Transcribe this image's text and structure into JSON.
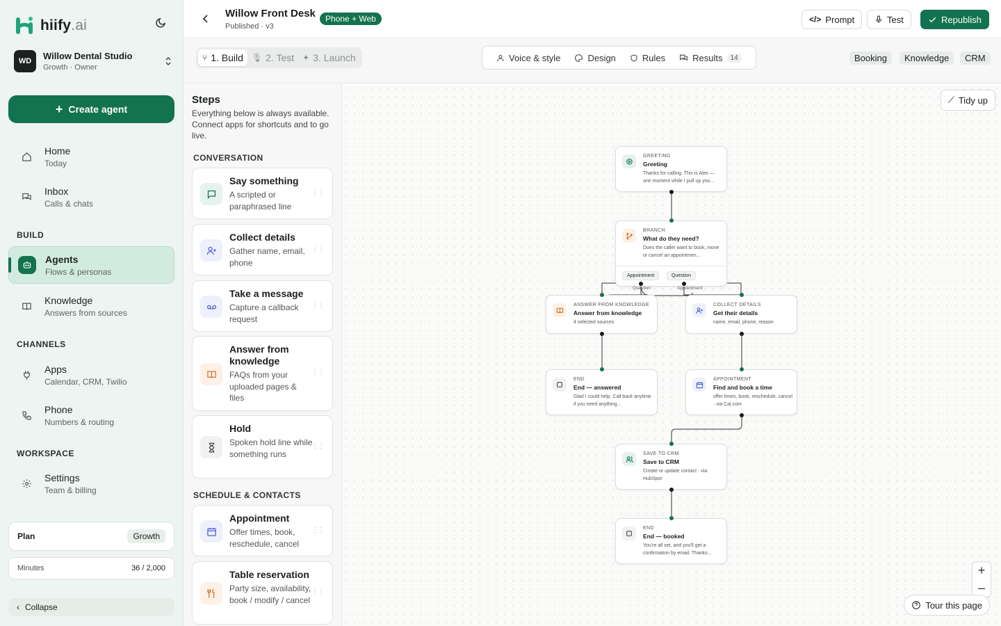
{
  "brand": {
    "name": "hiify",
    "suffix": ".ai",
    "accent": "#13724f"
  },
  "workspace": {
    "initials": "WD",
    "name": "Willow Dental Studio",
    "sub": "Growth · Owner"
  },
  "create_label": "Create agent",
  "nav": {
    "home": {
      "title": "Home",
      "sub": "Today"
    },
    "inbox": {
      "title": "Inbox",
      "sub": "Calls & chats"
    },
    "build_label": "BUILD",
    "agents": {
      "title": "Agents",
      "sub": "Flows & personas"
    },
    "knowledge": {
      "title": "Knowledge",
      "sub": "Answers from sources"
    },
    "channels_label": "CHANNELS",
    "apps": {
      "title": "Apps",
      "sub": "Calendar, CRM, Twilio"
    },
    "phone": {
      "title": "Phone",
      "sub": "Numbers & routing"
    },
    "workspace_label": "WORKSPACE",
    "settings": {
      "title": "Settings",
      "sub": "Team & billing"
    }
  },
  "plan": {
    "label": "Plan",
    "value": "Growth"
  },
  "minutes": {
    "label": "Minutes",
    "value": "36 / 2,000"
  },
  "collapse_label": "Collapse",
  "header": {
    "title": "Willow Front Desk",
    "subtitle": "Published · v3",
    "badge": "Phone + Web",
    "prompt": "Prompt",
    "test": "Test",
    "republish": "Republish"
  },
  "toolbar": {
    "steps": [
      "1. Build",
      "2. Test",
      "3. Launch"
    ],
    "tabs": {
      "voice": "Voice & style",
      "design": "Design",
      "rules": "Rules",
      "results": "Results",
      "results_count": "14"
    },
    "chips": [
      "Booking",
      "Knowledge",
      "CRM"
    ]
  },
  "palette": {
    "title": "Steps",
    "desc": "Everything below is always available. Connect apps for shortcuts and to go live.",
    "conversation_label": "CONVERSATION",
    "schedule_label": "SCHEDULE & CONTACTS",
    "cards": [
      {
        "title": "Say something",
        "sub": "A scripted or paraphrased line",
        "icon": "chat-bubble-icon"
      },
      {
        "title": "Collect details",
        "sub": "Gather name, email, phone",
        "icon": "user-plus-icon"
      },
      {
        "title": "Take a message",
        "sub": "Capture a callback request",
        "icon": "voicemail-icon"
      },
      {
        "title": "Answer from knowledge",
        "sub": "FAQs from your uploaded pages & files",
        "icon": "book-icon"
      },
      {
        "title": "Hold",
        "sub": "Spoken hold line while something runs",
        "icon": "hourglass-icon"
      },
      {
        "title": "Appointment",
        "sub": "Offer times, book, reschedule, cancel",
        "icon": "calendar-icon"
      },
      {
        "title": "Table reservation",
        "sub": "Party size, availability, book / modify / cancel",
        "icon": "utensils-icon"
      }
    ]
  },
  "canvas": {
    "tidy": "Tidy up",
    "tour": "Tour this page",
    "zoom_in": "+",
    "zoom_out": "–"
  },
  "flow": {
    "greeting": {
      "kind": "GREETING",
      "title": "Greeting",
      "sub": "Thanks for calling. This is Alex — one moment while I pull up you..."
    },
    "branch": {
      "kind": "BRANCH",
      "title": "What do they need?",
      "sub": "Does the caller want to book, move or cancel an appointmen...",
      "options": [
        "Appointment",
        "Question"
      ]
    },
    "edge_labels": [
      "Question",
      "Appointment"
    ],
    "answer": {
      "kind": "ANSWER FROM KNOWLEDGE",
      "title": "Answer from knowledge",
      "sub": "4 selected sources"
    },
    "collect": {
      "kind": "COLLECT DETAILS",
      "title": "Get their details",
      "sub": "name, email, phone, reason"
    },
    "end_answered": {
      "kind": "END",
      "title": "End — answered",
      "sub": "Glad I could help. Call back anytime if you need anything..."
    },
    "appointment": {
      "kind": "APPOINTMENT",
      "title": "Find and book a time",
      "sub": "offer times, book, reschedule, cancel · via Cal.com"
    },
    "crm": {
      "kind": "SAVE TO CRM",
      "title": "Save to CRM",
      "sub": "Create or update contact · via HubSpot"
    },
    "end_booked": {
      "kind": "END",
      "title": "End — booked",
      "sub": "You're all set, and you'll get a confirmation by email. Thanks..."
    }
  }
}
